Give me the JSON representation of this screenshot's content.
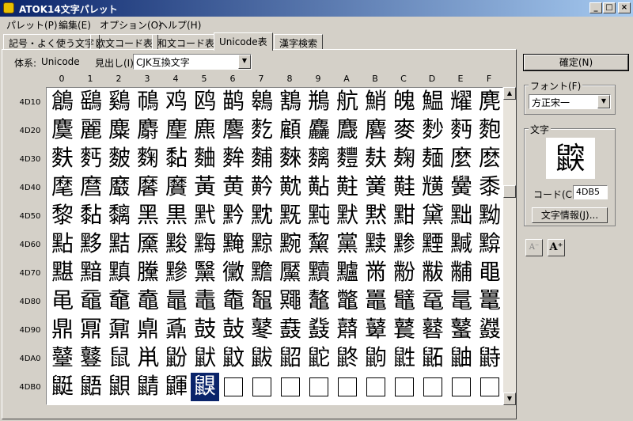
{
  "window": {
    "title": "ATOK14文字パレット",
    "minimize": "_",
    "maximize": "□",
    "close": "×"
  },
  "menu": [
    "パレット(P)",
    "編集(E)",
    "オプション(O)",
    "ヘルプ(H)"
  ],
  "tabs": [
    "記号・よく使う文字",
    "欧文コード表",
    "和文コード表",
    "Unicode表",
    "漢字検索"
  ],
  "active_tab": 3,
  "encoding": {
    "label": "体系:",
    "value": "Unicode"
  },
  "heading": {
    "label": "見出し(I)",
    "value": "CJK互換文字"
  },
  "columns": [
    "0",
    "1",
    "2",
    "3",
    "4",
    "5",
    "6",
    "7",
    "8",
    "9",
    "A",
    "B",
    "C",
    "D",
    "E",
    "F"
  ],
  "rows": [
    "4D10",
    "4D20",
    "4D30",
    "4D40",
    "4D50",
    "4D60",
    "4D70",
    "4D80",
    "4D90",
    "4DA0",
    "4DB0"
  ],
  "glyph_rows": [
    "鶬鷂鷄鳾鸡鸥鹋鷎鶷鵧航鮹魄鰛耀麂",
    "麌麗麋麝麈麃麐麧顧麤麙麔麥麨麪麭",
    "麩麫麬麴黏麯麰麱麳麶麷麸麹麺麼麽",
    "麾麿黀黁黂黃黄黅黆黇黈黉黊黋黌黍",
    "黎黏黐黑黒黓黔黕黖黗默黙黚黛黜黝",
    "點黟黠黡黢黣黤黥黦黧黨黩黪黫黬黭",
    "黮黯黰黱黲黳黴黵黶黷黸黹黺黻黼黽",
    "黾黿鼀鼁鼂鼃鼄鼅鼆鼇鼈鼉鼊鼋鼌鼍",
    "鼎鼏鼐鼑鼒鼓鼔鼕鼖鼗鼘鼙鼚鼛鼜鼝",
    "鼞鼟鼠鼡鼢鼣鼤鼥鼦鼧鼨鼩鼪鼫鼬鼭",
    "鼮鼯鼰鼱鼲鼳"
  ],
  "selected": {
    "row": 10,
    "col": 5
  },
  "empty_cells_after": 6,
  "scroll": {
    "up": "▲",
    "down": "▼"
  },
  "confirm_button": "確定(N)",
  "font": {
    "group_label": "フォント(F)",
    "value": "方正宋一"
  },
  "char": {
    "group_label": "文字",
    "preview": "鼵",
    "code_label": "コード(C)",
    "code_value": "4DB5",
    "info_button": "文字情報(J)..."
  },
  "size_buttons": {
    "smaller": "A⁻",
    "larger": "A⁺"
  },
  "colors": {
    "title_start": "#0a246a",
    "title_end": "#a6caf0",
    "selection": "#0a246a",
    "face": "#d4d0c8"
  }
}
